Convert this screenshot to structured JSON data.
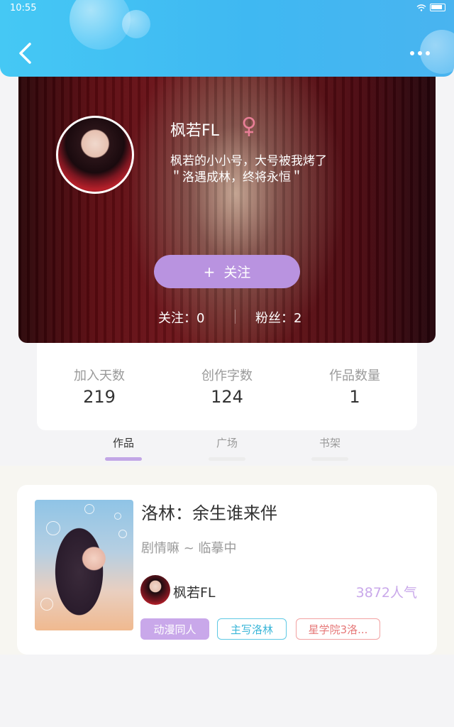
{
  "status_bar": {
    "time": "10:55",
    "icons": [
      "wifi-icon",
      "battery-icon"
    ]
  },
  "header": {
    "back_icon": "chevron-left-icon",
    "more_icon": "more-dots-icon",
    "background_color": "#3fb8f2"
  },
  "profile": {
    "username": "枫若FL",
    "gender_symbol": "♀",
    "gender_color": "#e87e96",
    "bio_line1": "枫若的小小号，大号被我烤了",
    "bio_line2": "＂洛遇成林，终将永恒＂",
    "follow_button_plus": "+",
    "follow_button_label": "关注",
    "follow_button_color": "#b993e0",
    "following_text": "关注：0",
    "fans_text": "粉丝：2"
  },
  "stats": [
    {
      "label": "加入天数",
      "value": "219"
    },
    {
      "label": "创作字数",
      "value": "124"
    },
    {
      "label": "作品数量",
      "value": "1"
    }
  ],
  "tabs": [
    {
      "label": "作品",
      "active": true
    },
    {
      "label": "广场",
      "active": false
    },
    {
      "label": "书架",
      "active": false
    }
  ],
  "work": {
    "title": "洛林：余生谁来伴",
    "subtitle": "剧情嘛 ~ 临摹中",
    "author_name": "枫若FL",
    "popularity": "3872人气",
    "tags": [
      "动漫同人",
      "主写洛林",
      "星学院3洛..."
    ],
    "accent_color": "#c9a8ea"
  }
}
